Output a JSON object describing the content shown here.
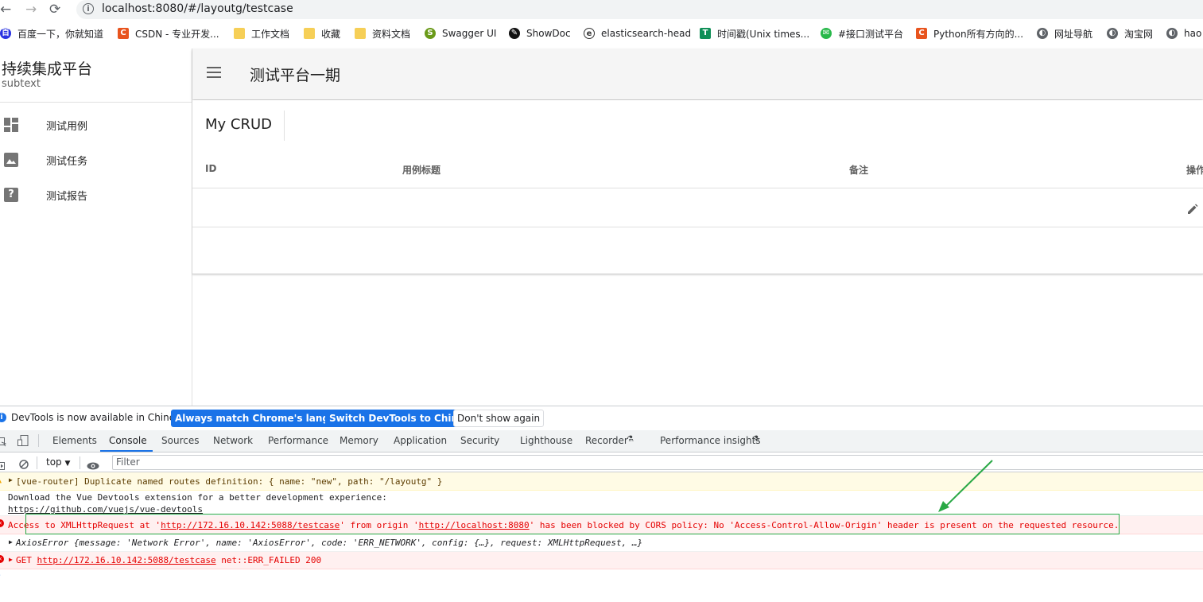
{
  "browser": {
    "url": "localhost:8080/#/layoutg/testcase",
    "bookmarks": [
      {
        "label": "百度一下，你就知道",
        "icon": "baidu-icon"
      },
      {
        "label": "CSDN - 专业开发...",
        "icon": "csdn-icon"
      },
      {
        "label": "工作文档",
        "icon": "folder-icon"
      },
      {
        "label": "收藏",
        "icon": "folder-icon"
      },
      {
        "label": "资料文档",
        "icon": "folder-icon"
      },
      {
        "label": "Swagger UI",
        "icon": "swagger-icon"
      },
      {
        "label": "ShowDoc",
        "icon": "showdoc-icon"
      },
      {
        "label": "elasticsearch-head",
        "icon": "elasticsearch-icon"
      },
      {
        "label": "时间戳(Unix times...",
        "icon": "timestamp-icon"
      },
      {
        "label": "#接口测试平台",
        "icon": "wechat-icon"
      },
      {
        "label": "Python所有方向的...",
        "icon": "csdn-icon"
      },
      {
        "label": "网址导航",
        "icon": "globe-icon"
      },
      {
        "label": "淘宝网",
        "icon": "globe-icon"
      },
      {
        "label": "hao",
        "icon": "globe-icon"
      }
    ]
  },
  "app": {
    "title": "持续集成平台",
    "subtitle": "subtext",
    "header_title": "测试平台一期",
    "nav": [
      {
        "label": "测试用例",
        "icon": "dashboard-icon"
      },
      {
        "label": "测试任务",
        "icon": "image-icon"
      },
      {
        "label": "测试报告",
        "icon": "help-icon"
      }
    ],
    "card_title": "My CRUD",
    "columns": [
      "ID",
      "用例标题",
      "备注",
      "操作"
    ]
  },
  "devtools": {
    "notice": "DevTools is now available in Chinese!",
    "btn_match": "Always match Chrome's language",
    "btn_switch": "Switch DevTools to Chinese",
    "btn_dismiss": "Don't show again",
    "tabs": [
      "Elements",
      "Console",
      "Sources",
      "Network",
      "Performance",
      "Memory",
      "Application",
      "Security",
      "Lighthouse",
      "Recorder",
      "Performance insights"
    ],
    "active_tab": "Console",
    "context": "top",
    "filter_placeholder": "Filter",
    "logs": {
      "warn": "[vue-router] Duplicate named routes definition: { name: \"new\", path: \"/layoutg\" }",
      "info_line1": "Download the Vue Devtools extension for a better development experience:",
      "info_link": "https://github.com/vuejs/vue-devtools",
      "cors_prefix": "Access to XMLHttpRequest at '",
      "cors_url": "http://172.16.10.142:5088/testcase",
      "cors_mid": "' from origin '",
      "cors_origin": "http://localhost:8080",
      "cors_suffix": "' has been blocked by CORS policy: No 'Access-Control-Allow-Origin' header is present on the requested resource.",
      "axios": "AxiosError {message: 'Network Error', name: 'AxiosError', code: 'ERR_NETWORK', config: {…}, request: XMLHttpRequest, …}",
      "get_prefix": "GET ",
      "get_url": "http://172.16.10.142:5088/testcase",
      "get_suffix": " net::ERR_FAILED 200"
    }
  }
}
